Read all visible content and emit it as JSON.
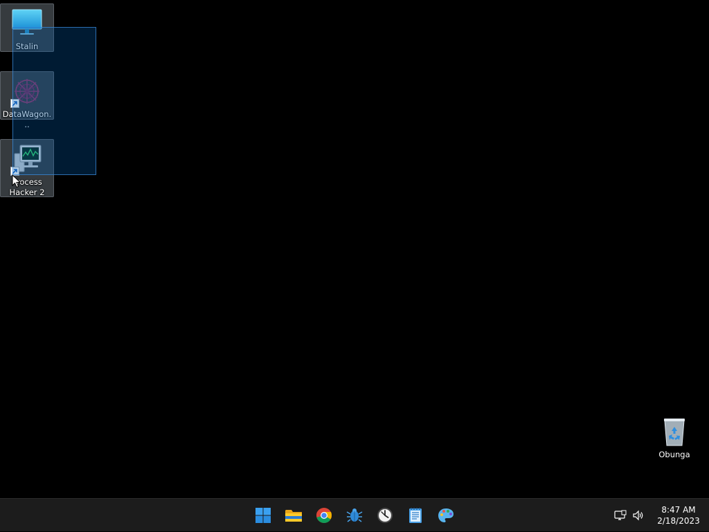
{
  "desktop": {
    "background": "#000000",
    "icons": [
      {
        "label": "Stalin",
        "icon": "monitor-icon",
        "shortcut": false
      },
      {
        "label": "DataWagon...",
        "icon": "datawagon-app-icon",
        "shortcut": true
      },
      {
        "label": "Process\nHacker 2",
        "icon": "process-hacker-icon",
        "shortcut": true
      },
      {
        "label": "Obunga",
        "icon": "recycle-bin-icon",
        "shortcut": false
      }
    ]
  },
  "taskbar": {
    "apps": [
      {
        "name": "Start",
        "icon": "windows-start-icon"
      },
      {
        "name": "File Explorer",
        "icon": "folder-icon"
      },
      {
        "name": "Google Chrome",
        "icon": "chrome-icon"
      },
      {
        "name": "App",
        "icon": "blue-bug-app-icon"
      },
      {
        "name": "Clock",
        "icon": "clock-app-icon"
      },
      {
        "name": "Notepad",
        "icon": "notepad-icon"
      },
      {
        "name": "Paint",
        "icon": "paint-icon"
      }
    ],
    "tray": {
      "network_icon": "network-icon",
      "volume_icon": "volume-icon",
      "time": "8:47 AM",
      "date": "2/18/2023"
    }
  },
  "colors": {
    "accent": "#0078d4",
    "taskbar_bg": "#1c1c1c",
    "selection_fill": "#005aaa"
  }
}
